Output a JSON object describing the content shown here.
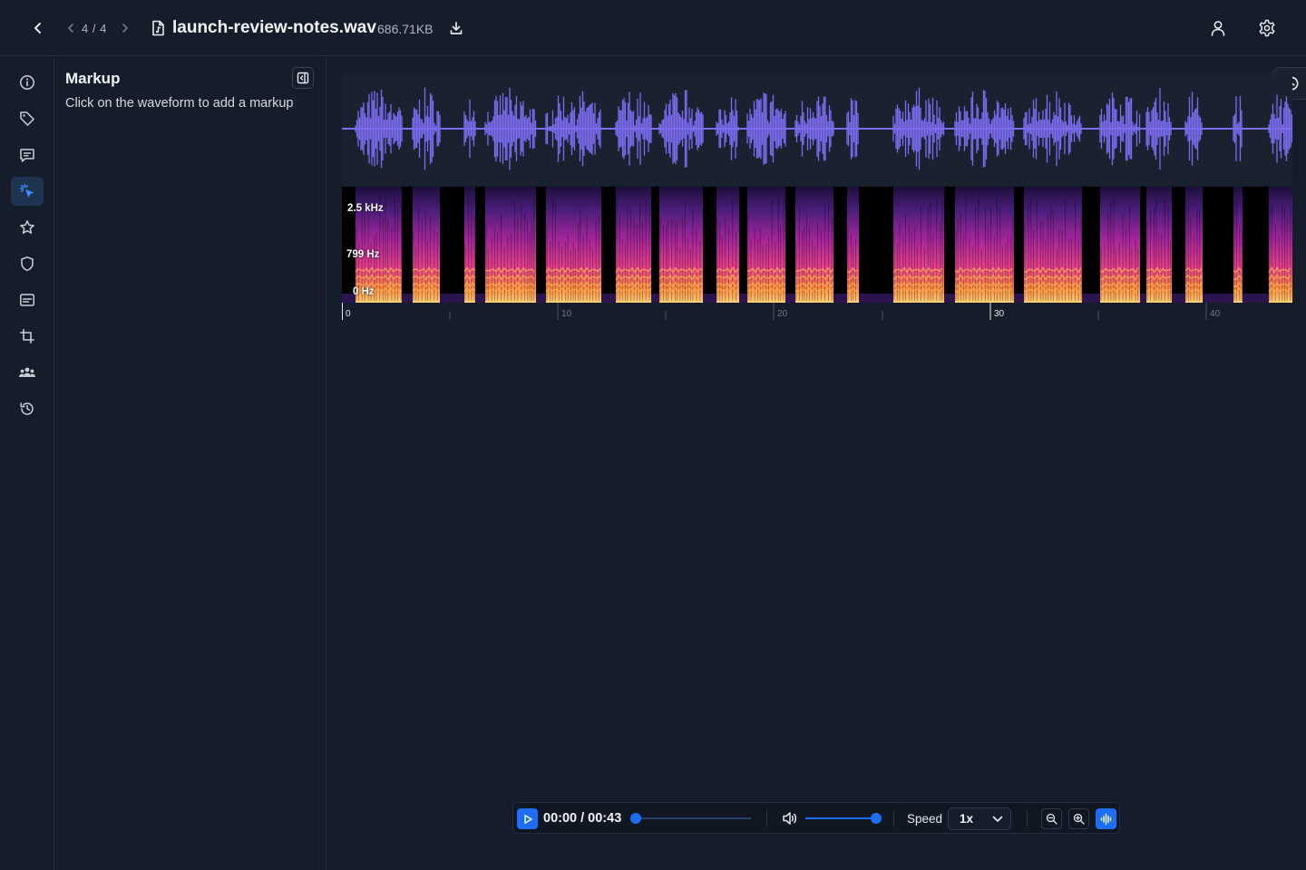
{
  "header": {
    "pager": "4 / 4",
    "file_name": "launch-review-notes.wav",
    "file_size": "686.71KB"
  },
  "icons": {
    "back": "chevron-left-icon",
    "prev": "chevron-left-icon",
    "next": "chevron-right-icon",
    "file": "audio-file-icon",
    "download": "download-icon",
    "user": "user-icon",
    "settings": "gear-icon"
  },
  "sidebar": {
    "items": [
      {
        "name": "info",
        "icon": "info-icon",
        "active": false
      },
      {
        "name": "tags",
        "icon": "tag-icon",
        "active": false
      },
      {
        "name": "comments",
        "icon": "comment-icon",
        "active": false
      },
      {
        "name": "markup",
        "icon": "markup-cursor-icon",
        "active": true
      },
      {
        "name": "favorites",
        "icon": "star-icon",
        "active": false
      },
      {
        "name": "security",
        "icon": "shield-icon",
        "active": false
      },
      {
        "name": "transcript",
        "icon": "subtitles-icon",
        "active": false
      },
      {
        "name": "crop",
        "icon": "crop-icon",
        "active": false
      },
      {
        "name": "collaborators",
        "icon": "users-icon",
        "active": false
      },
      {
        "name": "history",
        "icon": "history-icon",
        "active": false
      }
    ]
  },
  "markup_panel": {
    "title": "Markup",
    "hint": "Click on the waveform to add a markup"
  },
  "spectrogram": {
    "labels": [
      "2.5 kHz",
      "799  Hz",
      "0   Hz"
    ]
  },
  "timeline": {
    "ticks": [
      "0",
      "10",
      "20",
      "30",
      "40"
    ]
  },
  "player": {
    "time": "00:00 / 00:43",
    "progress": 0,
    "volume": 1,
    "speed_label": "Speed",
    "speed_value": "1x"
  },
  "colors": {
    "accent": "#1d6ef5",
    "waveform": "#7b6cf0",
    "background": "#161d2a"
  }
}
